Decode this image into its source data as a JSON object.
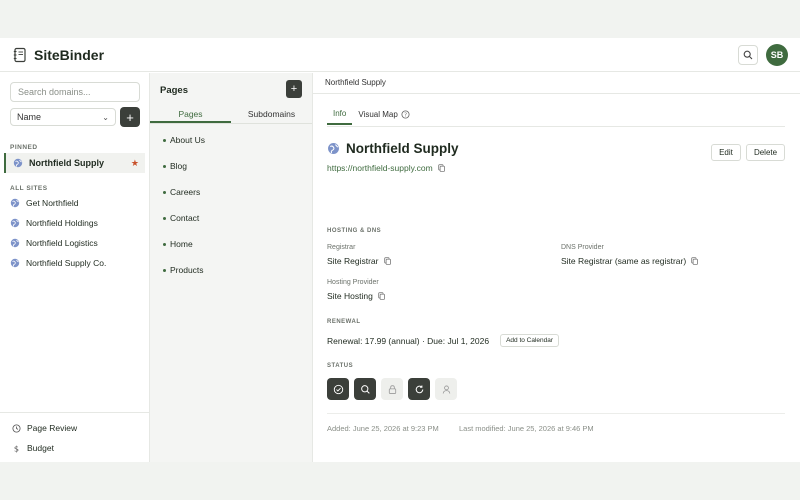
{
  "header": {
    "brand_name": "SiteBinder",
    "avatar_initials": "SB"
  },
  "sidebar": {
    "search_placeholder": "Search domains...",
    "sort_value": "Name",
    "add_symbol": "+",
    "pinned_label": "PINNED",
    "pinned_items": [
      {
        "label": "Northfield Supply",
        "star": "★"
      }
    ],
    "all_sites_label": "ALL SITES",
    "sites": [
      {
        "label": "Get Northfield"
      },
      {
        "label": "Northfield Holdings"
      },
      {
        "label": "Northfield Logistics"
      },
      {
        "label": "Northfield Supply Co."
      }
    ],
    "bottom_items": [
      {
        "label": "Page Review",
        "icon": "clock-icon"
      },
      {
        "label": "Budget",
        "icon": "dollar-icon"
      }
    ]
  },
  "pages_panel": {
    "title": "Pages",
    "add_symbol": "+",
    "tabs": [
      {
        "label": "Pages",
        "active": true
      },
      {
        "label": "Subdomains",
        "active": false
      }
    ],
    "pages": [
      "About Us",
      "Blog",
      "Careers",
      "Contact",
      "Home",
      "Products"
    ]
  },
  "main": {
    "breadcrumb": "Northfield Supply",
    "tabs": [
      {
        "label": "Info",
        "active": true
      },
      {
        "label": "Visual Map",
        "active": false
      }
    ],
    "site_title": "Northfield Supply",
    "site_url": "https://northfield-supply.com",
    "edit_label": "Edit",
    "delete_label": "Delete",
    "hosting_section_label": "HOSTING & DNS",
    "registrar_label": "Registrar",
    "registrar_value": "Site Registrar",
    "dns_label": "DNS Provider",
    "dns_value": "Site Registrar (same as registrar)",
    "hosting_label": "Hosting Provider",
    "hosting_value": "Site Hosting",
    "renewal_section_label": "RENEWAL",
    "renewal_text": "Renewal: 17.99 (annual) · Due: Jul 1, 2026",
    "add_calendar_label": "Add to Calendar",
    "status_section_label": "STATUS",
    "status_icons": [
      {
        "icon": "check-circle-icon",
        "active": true
      },
      {
        "icon": "search-icon",
        "active": true
      },
      {
        "icon": "lock-icon",
        "active": false
      },
      {
        "icon": "refresh-icon",
        "active": true
      },
      {
        "icon": "user-icon",
        "active": false
      }
    ],
    "added_text": "Added: June 25, 2026 at 9:23 PM",
    "modified_text": "Last modified: June 25, 2026 at 9:46 PM"
  },
  "colors": {
    "accent": "#3f6b3f",
    "dark_button": "#3b3f3a",
    "star": "#c8502a"
  }
}
